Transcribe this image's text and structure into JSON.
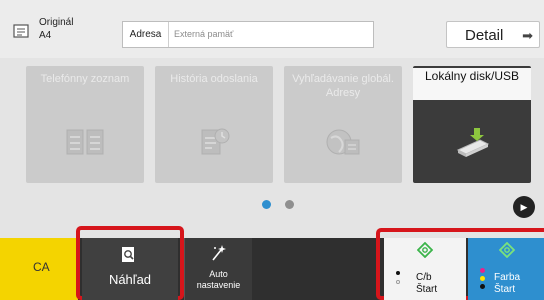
{
  "header": {
    "original_title": "Originál",
    "original_size": "A4",
    "address_label": "Adresa",
    "address_placeholder": "Externá pamäť",
    "detail_label": "Detail"
  },
  "tiles": [
    {
      "label": "Telefónny zoznam",
      "icon": "address-book-icon",
      "enabled": false
    },
    {
      "label": "História odoslania",
      "icon": "history-icon",
      "enabled": false
    },
    {
      "label": "Vyhľadávanie globál. Adresy",
      "icon": "global-search-icon",
      "enabled": false
    },
    {
      "label": "Lokálny disk/USB",
      "icon": "usb-icon",
      "enabled": true
    }
  ],
  "pagination": {
    "pages": 2,
    "current": 1
  },
  "bottom": {
    "ca_label": "CA",
    "preview_label": "Náhľad",
    "auto_label_1": "Auto",
    "auto_label_2": "nastavenie",
    "bw_label_1": "C/b",
    "bw_label_2": "Štart",
    "color_label_1": "Farba",
    "color_label_2": "Štart"
  },
  "colors": {
    "accent_blue": "#2e8fcf",
    "ca_yellow": "#f4d400",
    "highlight_red": "#d6151b",
    "start_green": "#3bb44a"
  }
}
